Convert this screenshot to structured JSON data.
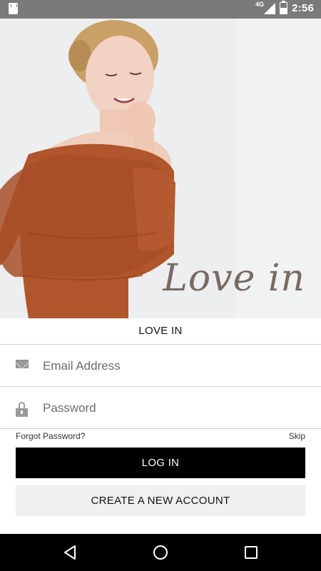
{
  "status_bar": {
    "network": "4G",
    "time": "2:56",
    "battery_level": 0.55
  },
  "hero": {
    "script_text": "Love in"
  },
  "brand": {
    "title": "LOVE IN"
  },
  "form": {
    "email_placeholder": "Email Address",
    "password_placeholder": "Password",
    "forgot_label": "Forgot Password?",
    "skip_label": "Skip",
    "login_label": "LOG IN",
    "create_label": "CREATE A NEW ACCOUNT"
  },
  "nav": {
    "icons": [
      "back-icon",
      "home-icon",
      "recents-icon"
    ]
  },
  "colors": {
    "primary_button": "#000000",
    "secondary_button": "#f0f0f0",
    "status_bar": "#7a7a7a",
    "sweater": "#b0552c"
  }
}
